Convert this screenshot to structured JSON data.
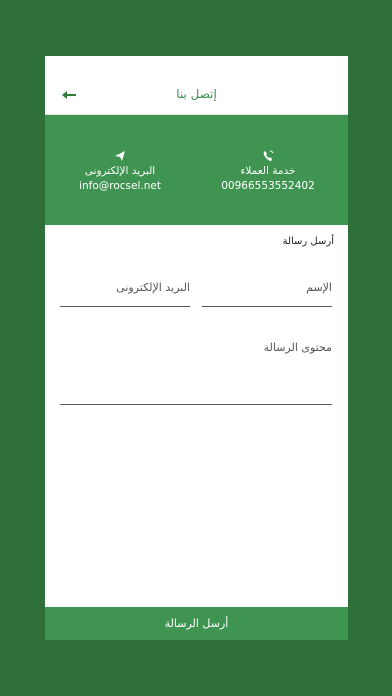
{
  "header": {
    "title": "إتصل بنا"
  },
  "contact": {
    "email": {
      "label": "البريد الإلكترونى",
      "value": "info@rocsel.net",
      "icon": "send-icon"
    },
    "phone": {
      "label": "خدمة العملاء",
      "value": "00966553552402",
      "icon": "phone-icon"
    }
  },
  "form": {
    "heading": "أرسل رسالة",
    "name_placeholder": "الإسم",
    "email_placeholder": "البريد الإلكترونى",
    "message_placeholder": "محتوى الرسالة",
    "submit_label": "أرسل الرسالة"
  },
  "colors": {
    "background": "#2f6f3a",
    "accent": "#3f9452",
    "header_text": "#3a8f4a"
  }
}
